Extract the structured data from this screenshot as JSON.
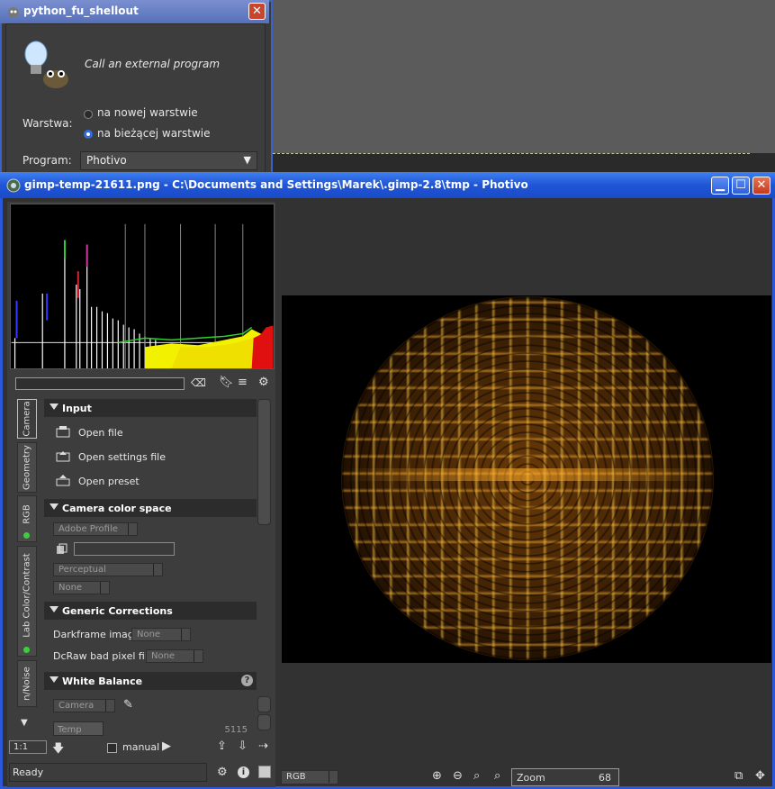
{
  "gimp_dialog": {
    "title": "python_fu_shellout",
    "description": "Call an external program",
    "layer_label": "Warstwa:",
    "radio_options": [
      "na nowej warstwie",
      "na bieżącej warstwie"
    ],
    "selected_radio": 1,
    "program_label": "Program:",
    "program_value": "Photivo"
  },
  "photivo": {
    "title": "gimp-temp-21611.png - C:\\Documents and Settings\\Marek\\.gimp-2.8\\tmp - Photivo",
    "tabs": [
      "Camera",
      "Geometry",
      "RGB",
      "Lab Color/Contrast",
      "n/Noise"
    ],
    "sections": {
      "input": {
        "title": "Input",
        "items": [
          "Open file",
          "Open settings file",
          "Open preset"
        ]
      },
      "camera_color_space": {
        "title": "Camera color space",
        "profile": "Adobe Profile",
        "intent": "Perceptual",
        "gamma": "None"
      },
      "generic_corrections": {
        "title": "Generic Corrections",
        "darkframe_label": "Darkframe image",
        "darkframe_value": "None",
        "badpixel_label": "DcRaw bad pixel file",
        "badpixel_value": "None"
      },
      "white_balance": {
        "title": "White Balance",
        "mode": "Camera",
        "temp_label": "Temp",
        "temp_value": "5115"
      }
    },
    "bottom": {
      "zoom_ratio": "1:1",
      "manual_label": "manual",
      "status": "Ready",
      "color_mode": "RGB",
      "zoom_label": "Zoom",
      "zoom_value": "68"
    }
  }
}
